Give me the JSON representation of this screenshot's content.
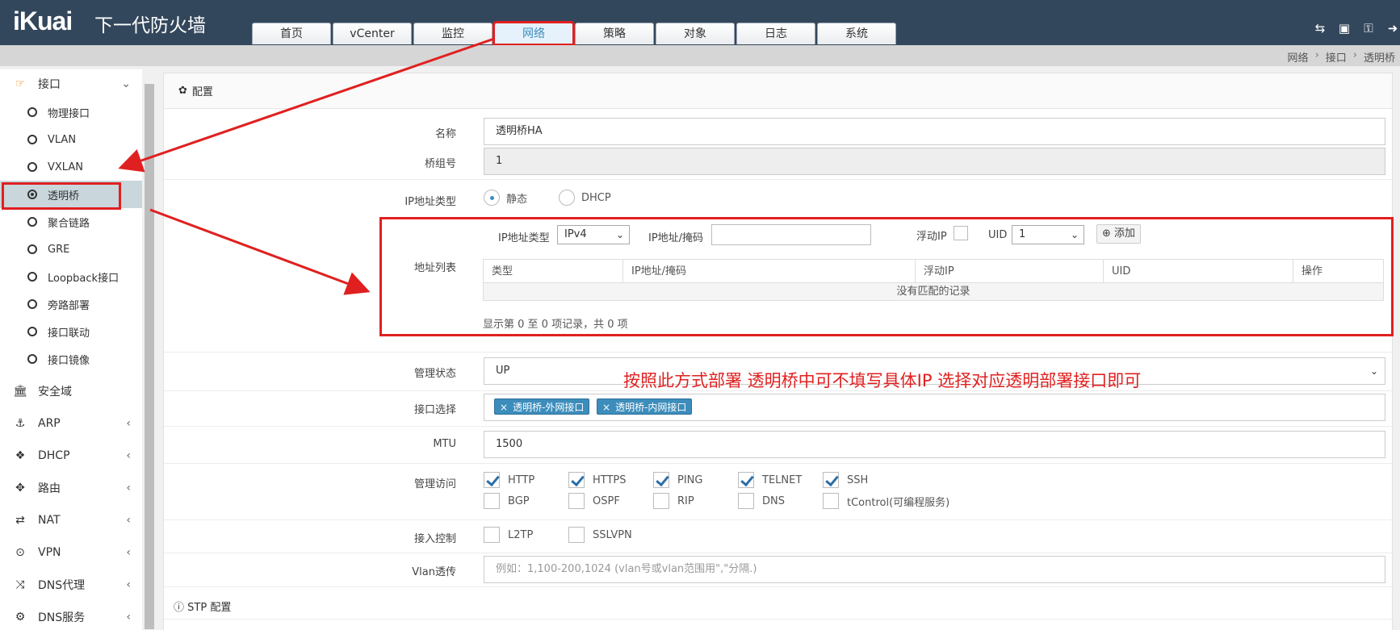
{
  "header": {
    "logo": "iKuai",
    "product": "下一代防火墙",
    "tabs": [
      {
        "label": "首页"
      },
      {
        "label": "vCenter"
      },
      {
        "label": "监控"
      },
      {
        "label": "网络"
      },
      {
        "label": "策略"
      },
      {
        "label": "对象"
      },
      {
        "label": "日志"
      },
      {
        "label": "系统"
      }
    ],
    "active_tab": "网络",
    "tool_icons": [
      "translate-icon",
      "save-icon",
      "key-icon",
      "logout-icon"
    ]
  },
  "breadcrumb": [
    "网络",
    "接口",
    "透明桥"
  ],
  "sidebar": {
    "interface_group": "接口",
    "interface_items": [
      "物理接口",
      "VLAN",
      "VXLAN",
      "透明桥",
      "聚合链路",
      "GRE",
      "Loopback接口",
      "旁路部署",
      "接口联动",
      "接口镜像"
    ],
    "active_item": "透明桥",
    "groups": [
      "安全域",
      "ARP",
      "DHCP",
      "路由",
      "NAT",
      "VPN",
      "DNS代理",
      "DNS服务"
    ]
  },
  "panel": {
    "title": "配置",
    "name_label": "名称",
    "name_value": "透明桥HA",
    "bridge_label": "桥组号",
    "bridge_value": "1",
    "ip_type_label": "IP地址类型",
    "ip_type_static": "静态",
    "ip_type_dhcp": "DHCP",
    "ip_type_selected": "静态",
    "addr_list": {
      "label": "地址列表",
      "ip_type_label": "IP地址类型",
      "ip_type_value": "IPv4",
      "ip_mask_label": "IP地址/掩码",
      "float_ip_label": "浮动IP",
      "uid_label": "UID",
      "uid_value": "1",
      "add_button": "添加",
      "columns": [
        "类型",
        "IP地址/掩码",
        "浮动IP",
        "UID",
        "操作"
      ],
      "empty_text": "没有匹配的记录",
      "footer": "显示第 0 至 0 项记录，共 0 项"
    },
    "mgmt_state_label": "管理状态",
    "mgmt_state_value": "UP",
    "annotation": "按照此方式部署 透明桥中可不填写具体IP  选择对应透明部署接口即可",
    "iface_label": "接口选择",
    "iface_tags": [
      "透明桥-外网接口",
      "透明桥-内网接口"
    ],
    "mtu_label": "MTU",
    "mtu_value": "1500",
    "mgmt_access_label": "管理访问",
    "mgmt_access_row1": [
      {
        "label": "HTTP",
        "checked": true
      },
      {
        "label": "HTTPS",
        "checked": true
      },
      {
        "label": "PING",
        "checked": true
      },
      {
        "label": "TELNET",
        "checked": true
      },
      {
        "label": "SSH",
        "checked": true
      }
    ],
    "mgmt_access_row2": [
      {
        "label": "BGP",
        "checked": false
      },
      {
        "label": "OSPF",
        "checked": false
      },
      {
        "label": "RIP",
        "checked": false
      },
      {
        "label": "DNS",
        "checked": false
      },
      {
        "label": "tControl(可编程服务)",
        "checked": false
      }
    ],
    "access_ctrl_label": "接入控制",
    "access_ctrl": [
      {
        "label": "L2TP",
        "checked": false
      },
      {
        "label": "SSLVPN",
        "checked": false
      }
    ],
    "vlan_label": "Vlan透传",
    "vlan_placeholder": "例如：1,100-200,1024 (vlan号或vlan范围用\",\"分隔.)",
    "stp_label": "STP 配置"
  },
  "colors": {
    "header_bg": "#33475c",
    "accent": "#3c8dbc",
    "highlight_red": "#e02020"
  }
}
